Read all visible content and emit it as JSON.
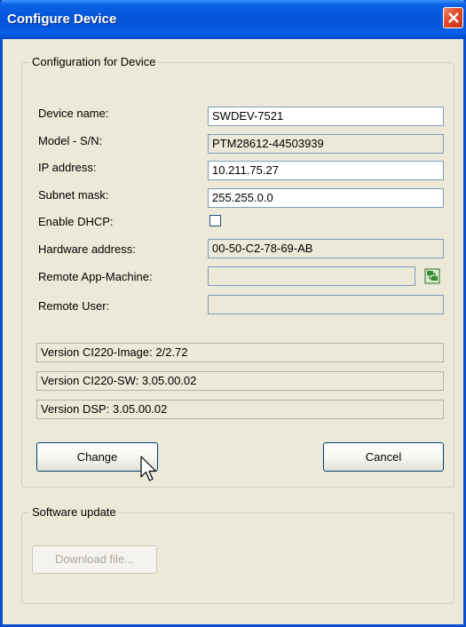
{
  "window": {
    "title": "Configure Device"
  },
  "config_group": {
    "title": "Configuration for Device",
    "fields": {
      "device_name": {
        "label": "Device name:",
        "value": "SWDEV-7521"
      },
      "model_sn": {
        "label": "Model - S/N:",
        "value": "PTM28612-44503939"
      },
      "ip_address": {
        "label": "IP address:",
        "value": "10.211.75.27"
      },
      "subnet_mask": {
        "label": "Subnet mask:",
        "value": "255.255.0.0"
      },
      "enable_dhcp": {
        "label": "Enable DHCP:",
        "checked": false
      },
      "hw_address": {
        "label": "Hardware address:",
        "value": "00-50-C2-78-69-AB"
      },
      "remote_app": {
        "label": "Remote App-Machine:",
        "value": ""
      },
      "remote_user": {
        "label": "Remote User:",
        "value": ""
      }
    },
    "versions": [
      "Version CI220-Image: 2/2.72",
      "Version CI220-SW:  3.05.00.02",
      "Version DSP:  3.05.00.02"
    ],
    "buttons": {
      "change": "Change",
      "cancel": "Cancel"
    }
  },
  "software_update": {
    "title": "Software update",
    "download_button": "Download file..."
  },
  "icons": {
    "close": "close-icon",
    "picker": "machine-picker-icon",
    "cursor": "mouse-pointer-icon"
  },
  "colors": {
    "titlebar": "#0454d8",
    "dialog_bg": "#ece9d8",
    "close_btn": "#e04a26"
  }
}
